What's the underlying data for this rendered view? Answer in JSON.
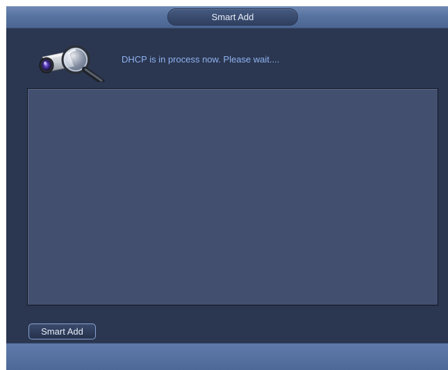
{
  "dialog": {
    "title": "Smart Add"
  },
  "status": {
    "message": "DHCP is in process now. Please wait...."
  },
  "device_list": {
    "items": []
  },
  "buttons": {
    "smart_add_label": "Smart Add"
  },
  "icons": {
    "status_icon": "camera-search-icon"
  },
  "colors": {
    "background": "#2b3650",
    "title_bar": "#5873a0",
    "status_text": "#8fb4f2",
    "list_background": "#434f6f"
  }
}
